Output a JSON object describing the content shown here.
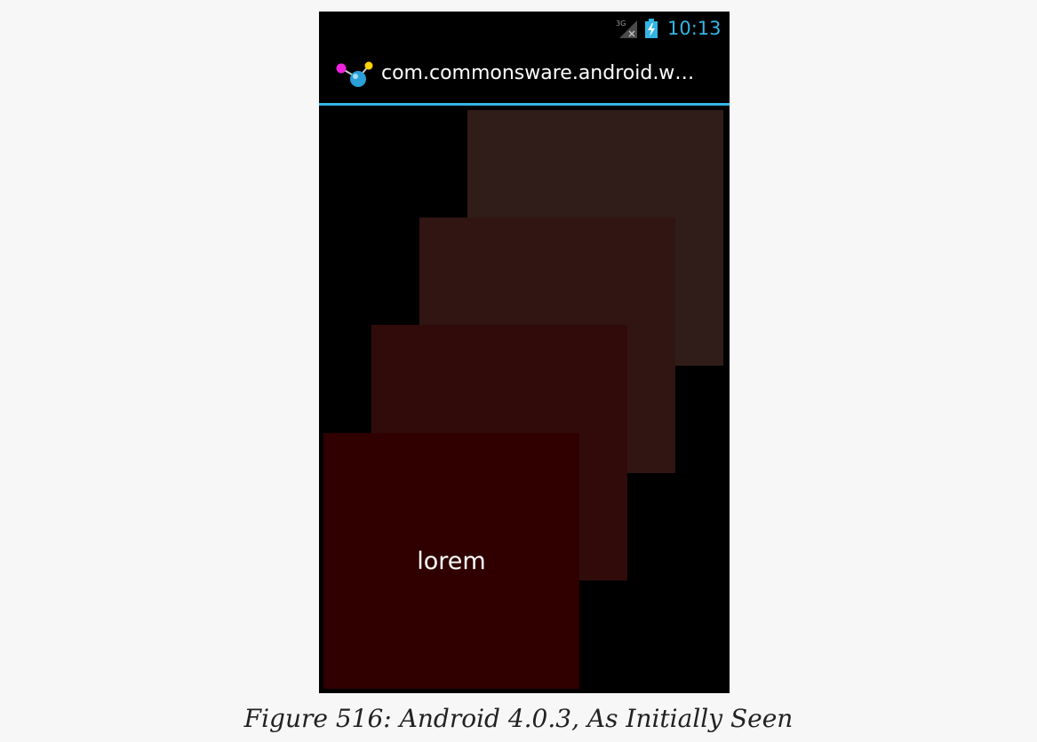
{
  "status_bar": {
    "network_type": "3G",
    "time": "10:13",
    "icons": [
      "signal-3g-icon",
      "battery-charging-icon"
    ]
  },
  "action_bar": {
    "icon": "app-molecule-icon",
    "title": "com.commonsware.android.w…"
  },
  "colors": {
    "accent": "#33b5e5",
    "background": "#000000",
    "page_background": "#f7f7f7",
    "cards": [
      "#301c18",
      "#301512",
      "#300b0a",
      "#300000"
    ]
  },
  "cards": [
    {
      "label": ""
    },
    {
      "label": ""
    },
    {
      "label": ""
    },
    {
      "label": "lorem"
    }
  ],
  "caption": "Figure 516: Android 4.0.3, As Initially Seen"
}
